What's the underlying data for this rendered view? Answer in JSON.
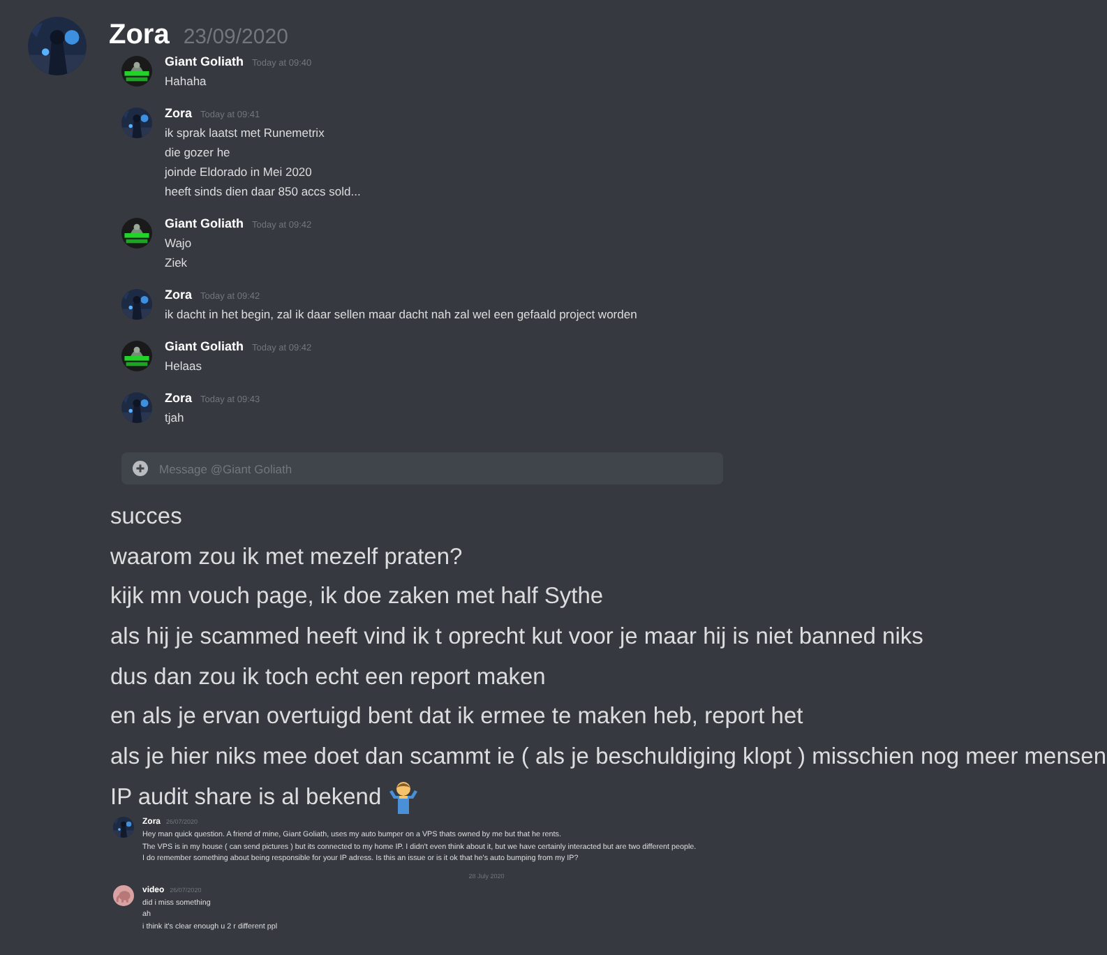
{
  "header": {
    "author": "Zora",
    "avatar": {
      "kind": "zora"
    },
    "date": "23/09/2020"
  },
  "dm_screenshot": {
    "messages": [
      {
        "author": "Giant Goliath",
        "avatar": {
          "kind": "goliath"
        },
        "timestamp": "Today at 09:40",
        "lines": [
          "Hahaha"
        ]
      },
      {
        "author": "Zora",
        "avatar": {
          "kind": "zora"
        },
        "timestamp": "Today at 09:41",
        "lines": [
          "ik sprak laatst met Runemetrix",
          "die gozer he",
          "joinde Eldorado in Mei 2020",
          "heeft sinds dien daar 850 accs sold..."
        ]
      },
      {
        "author": "Giant Goliath",
        "avatar": {
          "kind": "goliath"
        },
        "timestamp": "Today at 09:42",
        "lines": [
          "Wajo",
          "Ziek"
        ]
      },
      {
        "author": "Zora",
        "avatar": {
          "kind": "zora"
        },
        "timestamp": "Today at 09:42",
        "lines": [
          "ik dacht in het begin, zal ik daar sellen maar dacht nah zal wel een gefaald project worden"
        ]
      },
      {
        "author": "Giant Goliath",
        "avatar": {
          "kind": "goliath"
        },
        "timestamp": "Today at 09:42",
        "lines": [
          "Helaas"
        ]
      },
      {
        "author": "Zora",
        "avatar": {
          "kind": "zora"
        },
        "timestamp": "Today at 09:43",
        "lines": [
          "tjah"
        ]
      }
    ],
    "input": {
      "placeholder": "Message @Giant Goliath"
    }
  },
  "chat_lines": [
    {
      "text": "succes"
    },
    {
      "text": "waarom zou ik met mezelf praten?"
    },
    {
      "text": "kijk mn vouch page, ik doe zaken met half Sythe"
    },
    {
      "text": "als hij je scammed heeft vind ik t oprecht kut voor je maar hij is niet banned niks"
    },
    {
      "text": "dus dan zou ik toch echt een report maken"
    },
    {
      "text": "en als je ervan overtuigd bent dat ik ermee te maken heb, report het"
    },
    {
      "text": "als je hier niks mee doet dan scammt ie ( als je beschuldiging klopt ) misschien nog meer mensen"
    },
    {
      "text": "IP audit share is al bekend",
      "emoji": {
        "kind": "shrug"
      }
    }
  ],
  "support_screenshot": {
    "items": [
      {
        "kind": "message",
        "author": "Zora",
        "avatar": {
          "kind": "zora"
        },
        "timestamp": "26/07/2020",
        "lines": [
          "Hey man quick question. A friend of mine, Giant Goliath, uses my auto bumper on a VPS thats owned by me but that he rents.",
          "The VPS is in my house ( can send pictures ) but its connected to my home IP. I didn't even think about it, but we have certainly interacted but are two different people.",
          "I do remember something about being responsible for your IP adress. Is this an issue or is it ok that he's auto bumping from my IP?"
        ]
      },
      {
        "kind": "divider",
        "text": "28 July 2020"
      },
      {
        "kind": "message",
        "author": "video",
        "avatar": {
          "kind": "video"
        },
        "timestamp": "26/07/2020",
        "lines": [
          "did i miss something",
          "ah",
          "i think it's clear enough u 2 r different ppl"
        ]
      }
    ]
  }
}
